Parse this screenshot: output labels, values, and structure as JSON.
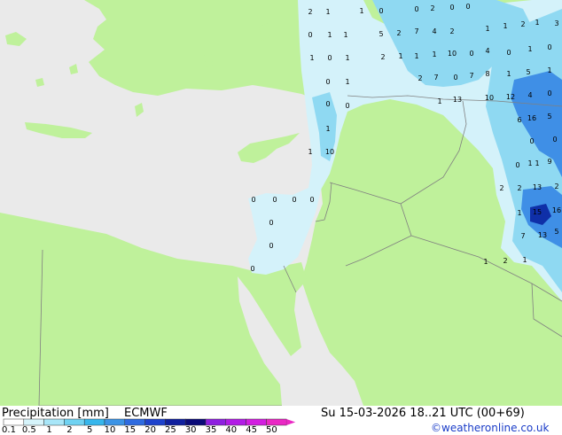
{
  "header": {
    "title": "Precipitation [mm]",
    "model": "ECMWF",
    "valid_time": "Su 15-03-2026 18..21 UTC (00+69)",
    "credit": "©weatheronline.co.uk"
  },
  "legend": {
    "ticks": [
      "0.1",
      "0.5",
      "1",
      "2",
      "5",
      "10",
      "15",
      "20",
      "25",
      "30",
      "35",
      "40",
      "45",
      "50"
    ],
    "colors": [
      "#ffffff",
      "#d6f4fb",
      "#a8e6f8",
      "#6fd2f2",
      "#36b6ec",
      "#3c94e6",
      "#2e6be0",
      "#1e42cc",
      "#10209e",
      "#0a0a78",
      "#8e20e0",
      "#b21ce6",
      "#d21ee0",
      "#ea28c4"
    ]
  },
  "colors": {
    "land": "#bff19b",
    "sea": "#eaeaea",
    "border": "#808080",
    "precip_light": "#d4f2fa",
    "precip_mid": "#8fd9f2",
    "precip_heavy": "#3f8fe6",
    "precip_max": "#0f2fa8"
  },
  "map_labels": [
    {
      "t": "2"
    },
    {
      "t": "1"
    },
    {
      "t": "1"
    },
    {
      "t": "0"
    },
    {
      "t": "0"
    },
    {
      "t": "2"
    },
    {
      "t": "0"
    },
    {
      "t": "0"
    },
    {
      "t": "0"
    },
    {
      "t": "1"
    },
    {
      "t": "1"
    },
    {
      "t": "5"
    },
    {
      "t": "2"
    },
    {
      "t": "7"
    },
    {
      "t": "4"
    },
    {
      "t": "2"
    },
    {
      "t": "1"
    },
    {
      "t": "1"
    },
    {
      "t": "2"
    },
    {
      "t": "1"
    },
    {
      "t": "3"
    },
    {
      "t": "1"
    },
    {
      "t": "0"
    },
    {
      "t": "1"
    },
    {
      "t": "2"
    },
    {
      "t": "1"
    },
    {
      "t": "1"
    },
    {
      "t": "1"
    },
    {
      "t": "10"
    },
    {
      "t": "0"
    },
    {
      "t": "4"
    },
    {
      "t": "0"
    },
    {
      "t": "1"
    },
    {
      "t": "0"
    },
    {
      "t": "0"
    },
    {
      "t": "1"
    },
    {
      "t": "2"
    },
    {
      "t": "7"
    },
    {
      "t": "0"
    },
    {
      "t": "7"
    },
    {
      "t": "8"
    },
    {
      "t": "1"
    },
    {
      "t": "5"
    },
    {
      "t": "1"
    },
    {
      "t": "0"
    },
    {
      "t": "0"
    },
    {
      "t": "1"
    },
    {
      "t": "13"
    },
    {
      "t": "10"
    },
    {
      "t": "12"
    },
    {
      "t": "4"
    },
    {
      "t": "0"
    },
    {
      "t": "1"
    },
    {
      "t": "6"
    },
    {
      "t": "16"
    },
    {
      "t": "5"
    },
    {
      "t": "1"
    },
    {
      "t": "10"
    },
    {
      "t": "0"
    },
    {
      "t": "0"
    },
    {
      "t": "1"
    },
    {
      "t": "0"
    },
    {
      "t": "1"
    },
    {
      "t": "9"
    },
    {
      "t": "2"
    },
    {
      "t": "2"
    },
    {
      "t": "13"
    },
    {
      "t": "2"
    },
    {
      "t": "0"
    },
    {
      "t": "0"
    },
    {
      "t": "0"
    },
    {
      "t": "0"
    },
    {
      "t": "1"
    },
    {
      "t": "15"
    },
    {
      "t": "16"
    },
    {
      "t": "0"
    },
    {
      "t": "7"
    },
    {
      "t": "13"
    },
    {
      "t": "5"
    },
    {
      "t": "0"
    },
    {
      "t": "1"
    },
    {
      "t": "2"
    },
    {
      "t": "1"
    },
    {
      "t": "0"
    }
  ]
}
